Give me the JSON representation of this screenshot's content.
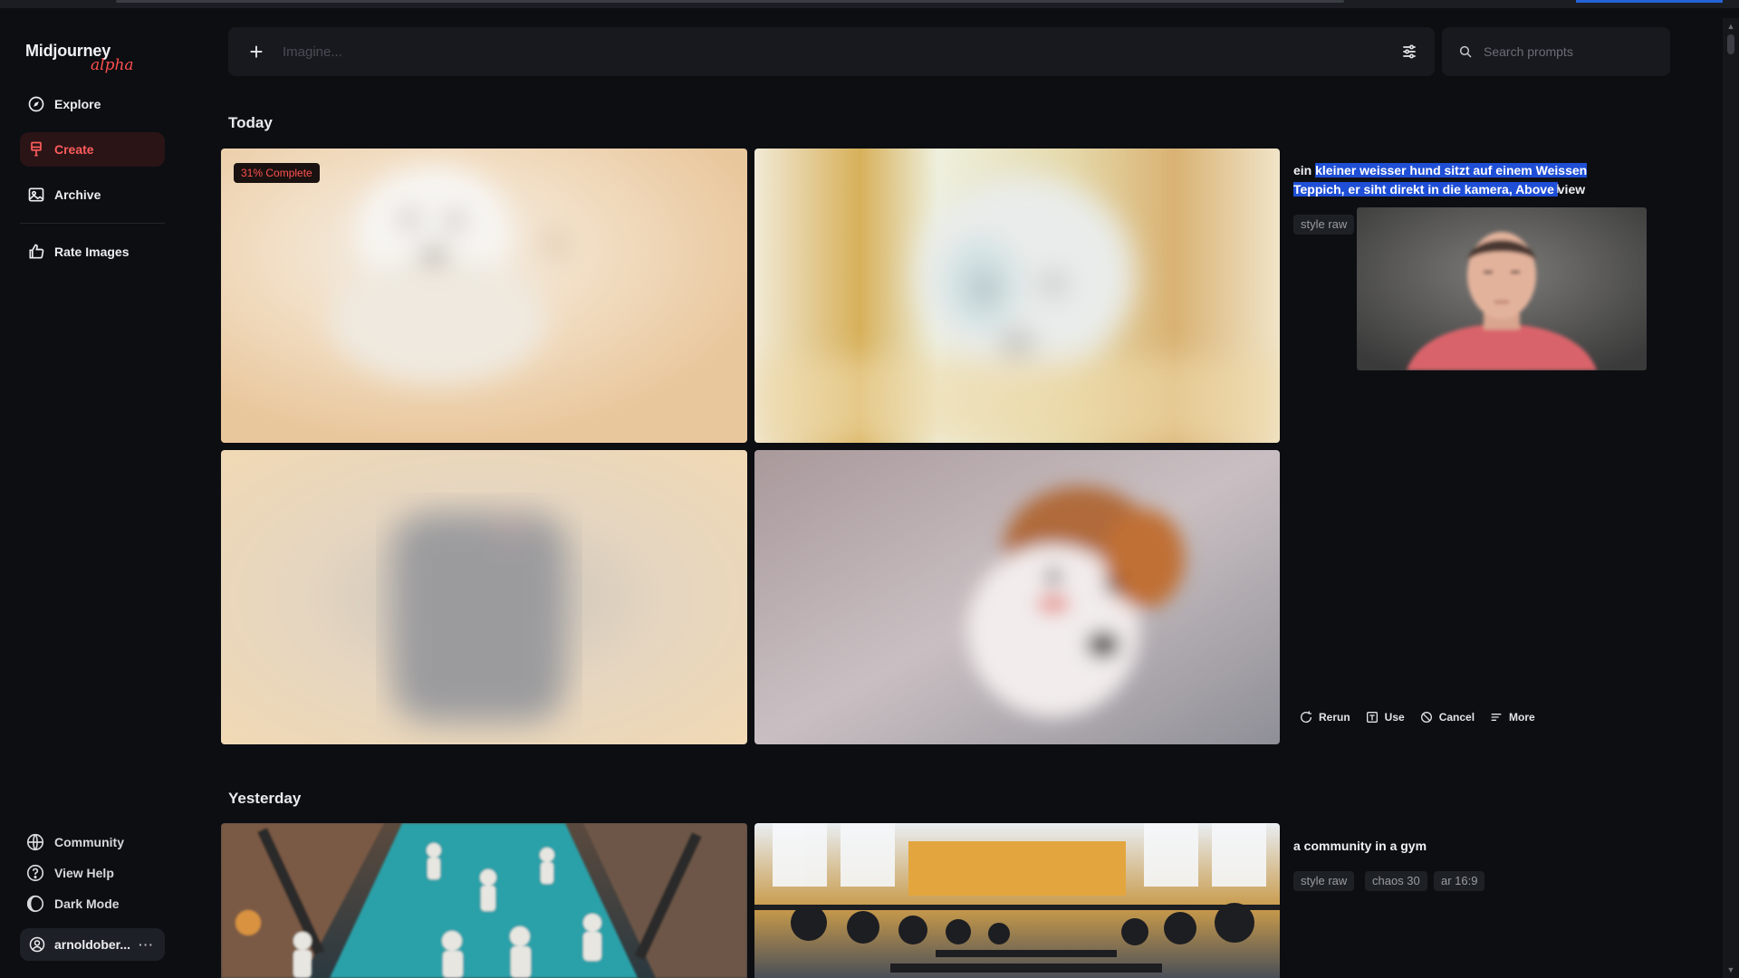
{
  "app": {
    "brand": "Midjourney",
    "brand_tag": "alpha"
  },
  "sidebar": {
    "nav": [
      {
        "label": "Explore",
        "icon": "compass-icon"
      },
      {
        "label": "Create",
        "icon": "brush-icon",
        "active": true
      },
      {
        "label": "Archive",
        "icon": "image-icon"
      },
      {
        "label": "Rate Images",
        "icon": "thumbs-up-icon"
      }
    ],
    "bottom": [
      {
        "label": "Community",
        "icon": "globe-icon"
      },
      {
        "label": "View Help",
        "icon": "help-icon"
      },
      {
        "label": "Dark Mode",
        "icon": "moon-icon"
      }
    ],
    "user": {
      "name": "arnoldober...",
      "menu": "···"
    }
  },
  "topbar": {
    "imagine_placeholder": "Imagine...",
    "search_placeholder": "Search prompts"
  },
  "sections": [
    {
      "title": "Today",
      "progress_badge": "31% Complete",
      "progress": 0.31,
      "prompt_plain": "ein ",
      "prompt_selected": "kleiner weisser hund sitzt auf einem Weissen Teppich, er siht direkt in die kamera, Above ",
      "prompt_tail": "view",
      "tags": [
        "style raw"
      ],
      "actions": [
        {
          "label": "Rerun",
          "icon": "rerun-icon"
        },
        {
          "label": "Use",
          "icon": "use-icon"
        },
        {
          "label": "Cancel",
          "icon": "cancel-icon"
        },
        {
          "label": "More",
          "icon": "more-icon"
        }
      ]
    },
    {
      "title": "Yesterday",
      "prompt": "a community in a gym",
      "tags": [
        "style raw",
        "chaos 30",
        "ar 16:9"
      ]
    }
  ],
  "colors": {
    "background": "#0c0e12",
    "accent": "#ff5c5c",
    "selection": "#1f4fd6"
  }
}
